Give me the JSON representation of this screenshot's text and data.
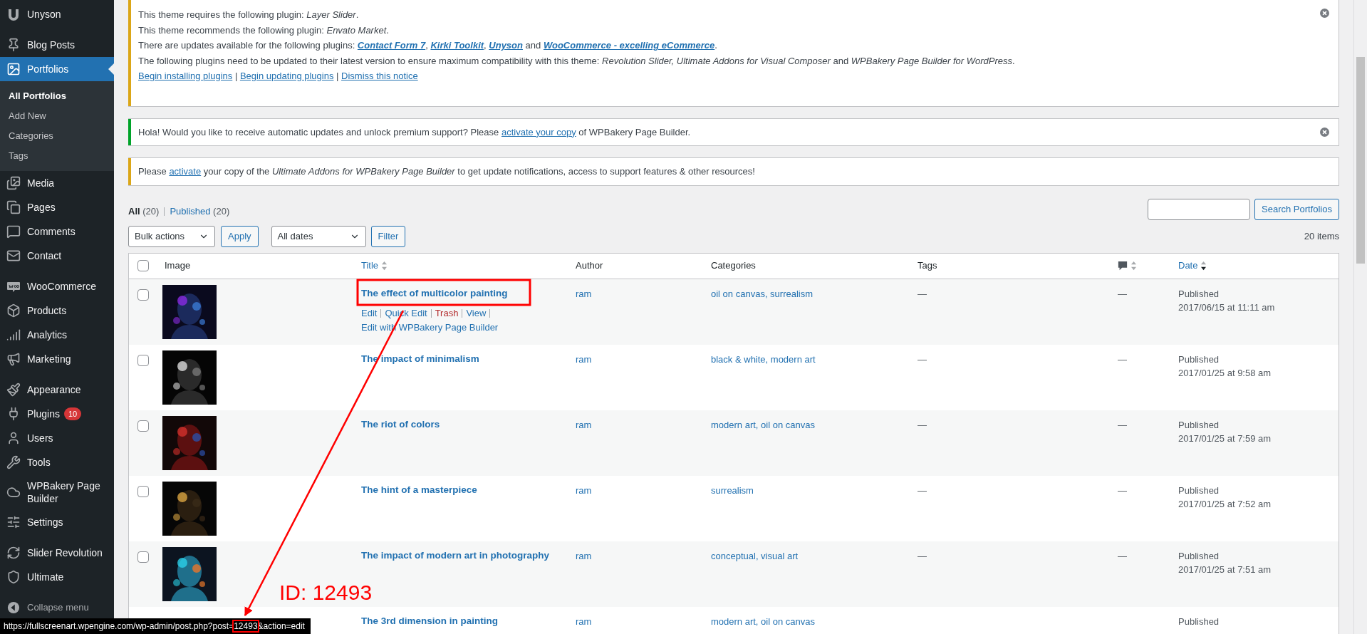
{
  "sidebar": {
    "groups": [
      [
        {
          "label": "Unyson",
          "selected": false
        }
      ],
      [
        {
          "label": "Blog Posts",
          "selected": false
        },
        {
          "label": "Portfolios",
          "selected": true,
          "children": [
            {
              "label": "All Portfolios",
              "selected": true
            },
            {
              "label": "Add New",
              "selected": false
            },
            {
              "label": "Categories",
              "selected": false
            },
            {
              "label": "Tags",
              "selected": false
            }
          ]
        },
        {
          "label": "Media",
          "selected": false
        },
        {
          "label": "Pages",
          "selected": false
        },
        {
          "label": "Comments",
          "selected": false
        },
        {
          "label": "Contact",
          "selected": false
        }
      ],
      [
        {
          "label": "WooCommerce",
          "selected": false
        },
        {
          "label": "Products",
          "selected": false
        },
        {
          "label": "Analytics",
          "selected": false
        },
        {
          "label": "Marketing",
          "selected": false
        }
      ],
      [
        {
          "label": "Appearance",
          "selected": false
        },
        {
          "label": "Plugins",
          "selected": false,
          "badge": "10"
        },
        {
          "label": "Users",
          "selected": false
        },
        {
          "label": "Tools",
          "selected": false
        },
        {
          "label": "WPBakery Page Builder",
          "selected": false
        },
        {
          "label": "Settings",
          "selected": false
        }
      ],
      [
        {
          "label": "Slider Revolution",
          "selected": false
        },
        {
          "label": "Ultimate",
          "selected": false
        }
      ]
    ],
    "collapse": "Collapse menu"
  },
  "notices": [
    {
      "color": "#dba617",
      "dismissible": true,
      "lines": [
        [
          {
            "kind": "text",
            "text": "This theme requires the following plugin: "
          },
          {
            "kind": "em",
            "text": "Layer Slider"
          },
          {
            "kind": "text",
            "text": "."
          }
        ],
        [
          {
            "kind": "text",
            "text": "This theme recommends the following plugin: "
          },
          {
            "kind": "em",
            "text": "Envato Market"
          },
          {
            "kind": "text",
            "text": "."
          }
        ],
        [
          {
            "kind": "text",
            "text": "There are updates available for the following plugins: "
          },
          {
            "kind": "em-link",
            "text": "Contact Form 7"
          },
          {
            "kind": "text",
            "text": ", "
          },
          {
            "kind": "em-link",
            "text": "Kirki Toolkit"
          },
          {
            "kind": "text",
            "text": ", "
          },
          {
            "kind": "em-link",
            "text": "Unyson"
          },
          {
            "kind": "text",
            "text": " and "
          },
          {
            "kind": "em-link",
            "text": "WooCommerce - excelling eCommerce"
          },
          {
            "kind": "text",
            "text": "."
          }
        ],
        [
          {
            "kind": "text",
            "text": "The following plugins need to be updated to their latest version to ensure maximum compatibility with this theme: "
          },
          {
            "kind": "em",
            "text": "Revolution Slider, Ultimate Addons for Visual Composer"
          },
          {
            "kind": "text",
            "text": " and "
          },
          {
            "kind": "em",
            "text": "WPBakery Page Builder for WordPress"
          },
          {
            "kind": "text",
            "text": "."
          }
        ],
        [
          {
            "kind": "link",
            "text": "Begin installing plugins"
          },
          {
            "kind": "text",
            "text": " | "
          },
          {
            "kind": "link",
            "text": "Begin updating plugins"
          },
          {
            "kind": "text",
            "text": " | "
          },
          {
            "kind": "link",
            "text": "Dismiss this notice"
          }
        ]
      ]
    },
    {
      "color": "#00a32a",
      "dismissible": true,
      "lines": [
        [
          {
            "kind": "text",
            "text": "Hola! Would you like to receive automatic updates and unlock premium support? Please "
          },
          {
            "kind": "link",
            "text": "activate your copy"
          },
          {
            "kind": "text",
            "text": " of WPBakery Page Builder."
          }
        ]
      ]
    },
    {
      "color": "#dba617",
      "dismissible": false,
      "lines": [
        [
          {
            "kind": "text",
            "text": "Please "
          },
          {
            "kind": "link",
            "text": "activate"
          },
          {
            "kind": "text",
            "text": " your copy of the "
          },
          {
            "kind": "em",
            "text": "Ultimate Addons for WPBakery Page Builder"
          },
          {
            "kind": "text",
            "text": " to get update notifications, access to support features & other resources!"
          }
        ]
      ]
    }
  ],
  "views": [
    {
      "label": "All",
      "count": "(20)",
      "selected": true
    },
    {
      "label": "Published",
      "count": "(20)",
      "selected": false
    }
  ],
  "search": {
    "button": "Search Portfolios"
  },
  "bulk_actions": {
    "select": "Bulk actions",
    "apply": "Apply",
    "dates": "All dates",
    "filter": "Filter",
    "count": "20 items"
  },
  "table": {
    "columns": [
      {
        "kind": "checkbox",
        "checked": false
      },
      {
        "kind": "text",
        "label": "Image"
      },
      {
        "kind": "sortable",
        "label": "Title",
        "sorted": false
      },
      {
        "kind": "text",
        "label": "Author"
      },
      {
        "kind": "text",
        "label": "Categories"
      },
      {
        "kind": "text",
        "label": "Tags"
      },
      {
        "kind": "comments",
        "sorted": false
      },
      {
        "kind": "sortable",
        "label": "Date",
        "sorted": true
      }
    ],
    "rows": [
      {
        "checked": false,
        "image": {
          "kind": "picture"
        },
        "title": "The effect of multicolor painting",
        "actions": [
          {
            "kind": "link",
            "label": "Edit"
          },
          {
            "kind": "link",
            "label": "Quick Edit"
          },
          {
            "kind": "trash",
            "label": "Trash"
          },
          {
            "kind": "link",
            "label": "View"
          },
          {
            "kind": "link",
            "label": "Edit with WPBakery Page Builder"
          }
        ],
        "author": "ram",
        "categories": "oil on canvas, surrealism",
        "tags": "—",
        "comments": "—",
        "status": "Published",
        "date": "2017/06/15 at 11:11 am"
      },
      {
        "checked": false,
        "image": {
          "kind": "picture"
        },
        "title": "The impact of minimalism",
        "author": "ram",
        "categories": "black & white, modern art",
        "tags": "—",
        "comments": "—",
        "status": "Published",
        "date": "2017/01/25 at 9:58 am"
      },
      {
        "checked": false,
        "image": {
          "kind": "picture"
        },
        "title": "The riot of colors",
        "author": "ram",
        "categories": "modern art, oil on canvas",
        "tags": "—",
        "comments": "—",
        "status": "Published",
        "date": "2017/01/25 at 7:59 am"
      },
      {
        "checked": false,
        "image": {
          "kind": "picture"
        },
        "title": "The hint of a masterpiece",
        "author": "ram",
        "categories": "surrealism",
        "tags": "—",
        "comments": "—",
        "status": "Published",
        "date": "2017/01/25 at 7:52 am"
      },
      {
        "checked": false,
        "image": {
          "kind": "picture"
        },
        "title": "The impact of modern art in photography",
        "author": "ram",
        "categories": "conceptual, visual art",
        "tags": "—",
        "comments": "—",
        "status": "Published",
        "date": "2017/01/25 at 7:51 am"
      },
      {
        "title": "The 3rd dimension in painting",
        "author": "ram",
        "categories": "modern art, oil on canvas",
        "status": "Published"
      }
    ]
  },
  "status_bar": {
    "url": [
      {
        "text": "https://fullscreenart.wpengine.com/wp-admin/post.php?post=",
        "highlighted": false
      },
      {
        "text": "12493",
        "highlighted": true
      },
      {
        "text": "&action=edit",
        "highlighted": false
      }
    ]
  },
  "annotation": {
    "label": "ID: 12493"
  }
}
